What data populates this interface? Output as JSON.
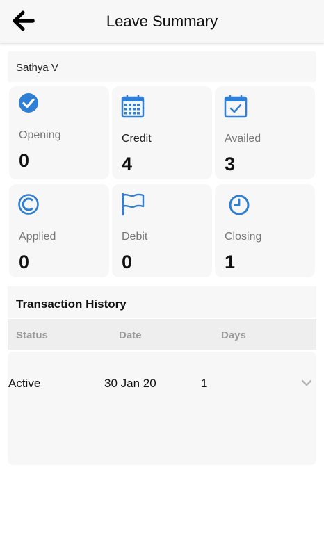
{
  "header": {
    "title": "Leave Summary",
    "back_icon": "arrow-left-icon"
  },
  "employee": {
    "name": "Sathya V"
  },
  "stats": [
    {
      "label": "Opening",
      "value": "0",
      "icon": "check-circle-icon"
    },
    {
      "label": "Credit",
      "value": "4",
      "icon": "calendar-grid-icon"
    },
    {
      "label": "Availed",
      "value": "3",
      "icon": "calendar-check-icon"
    },
    {
      "label": "Applied",
      "value": "0",
      "icon": "copyright-circle-icon"
    },
    {
      "label": "Debit",
      "value": "0",
      "icon": "flag-icon"
    },
    {
      "label": "Closing",
      "value": "1",
      "icon": "clock-icon"
    }
  ],
  "transactions": {
    "title": "Transaction History",
    "columns": [
      "Status",
      "Date",
      "Days"
    ],
    "rows": [
      {
        "status": "Active",
        "date": "30 Jan 20",
        "days": "1"
      }
    ]
  },
  "colors": {
    "accent": "#2f7fd6",
    "card_bg": "#f7f7f7"
  }
}
